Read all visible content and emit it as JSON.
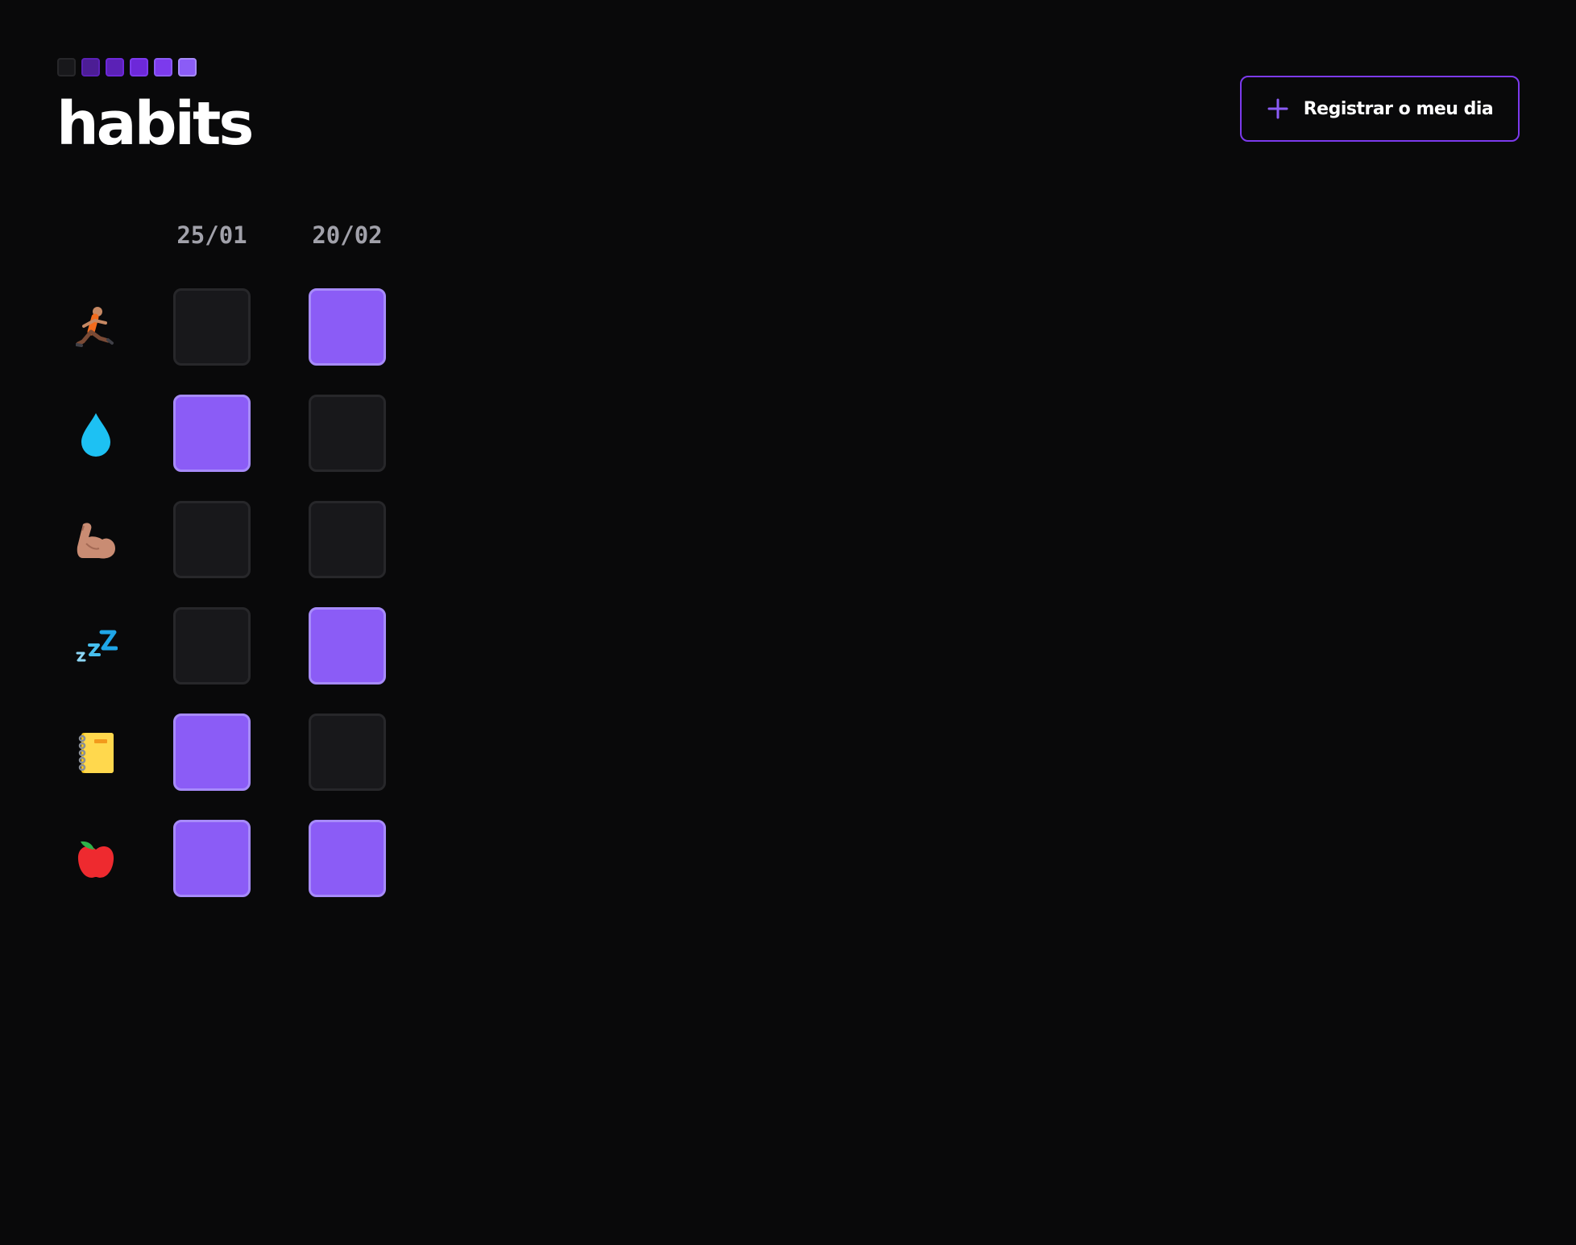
{
  "app": {
    "title": "habits",
    "logo_colors": [
      "#18181b",
      "#4c1d95",
      "#5b21b6",
      "#6d28d9",
      "#7c3aed",
      "#8b5cf6"
    ]
  },
  "header": {
    "new_button_label": "Registrar o meu dia",
    "new_button_icon": "plus-icon",
    "accent_color": "#8b5cf6"
  },
  "grid": {
    "dates": [
      "25/01",
      "20/02"
    ],
    "habits": [
      {
        "icon": "running-person-icon",
        "completed": [
          false,
          true
        ]
      },
      {
        "icon": "water-drop-icon",
        "completed": [
          true,
          false
        ]
      },
      {
        "icon": "flexed-biceps-icon",
        "completed": [
          false,
          false
        ]
      },
      {
        "icon": "sleeping-zzz-icon",
        "completed": [
          false,
          true
        ]
      },
      {
        "icon": "notebook-icon",
        "completed": [
          true,
          false
        ]
      },
      {
        "icon": "red-apple-icon",
        "completed": [
          true,
          true
        ]
      }
    ],
    "completed_color": "#8b5cf6",
    "empty_color": "#18181b"
  }
}
